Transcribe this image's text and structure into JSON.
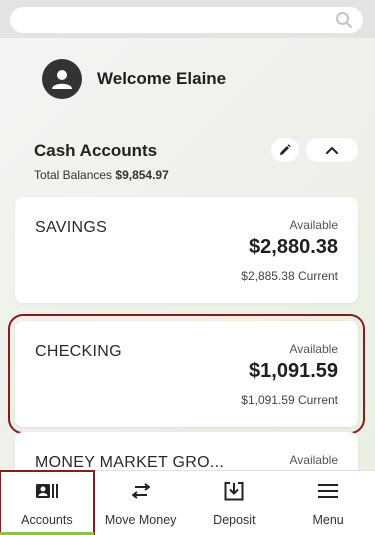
{
  "search": {
    "placeholder": ""
  },
  "welcome": {
    "text": "Welcome Elaine"
  },
  "cash_accounts": {
    "title": "Cash Accounts",
    "total_label": "Total Balances ",
    "total_value": "$9,854.97"
  },
  "accounts": [
    {
      "name": "SAVINGS",
      "available_label": "Available",
      "available": "$2,880.38",
      "current": "$2,885.38 Current"
    },
    {
      "name": "CHECKING",
      "available_label": "Available",
      "available": "$1,091.59",
      "current": "$1,091.59 Current"
    },
    {
      "name": "MONEY MARKET GRO...",
      "available_label": "Available",
      "available": "",
      "current": ""
    }
  ],
  "nav": {
    "items": [
      {
        "label": "Accounts",
        "icon": "accounts-icon"
      },
      {
        "label": "Move Money",
        "icon": "transfer-icon"
      },
      {
        "label": "Deposit",
        "icon": "deposit-icon"
      },
      {
        "label": "Menu",
        "icon": "menu-icon"
      }
    ]
  },
  "colors": {
    "highlight": "#8b1a1a",
    "active_underline": "#8bc34a"
  }
}
